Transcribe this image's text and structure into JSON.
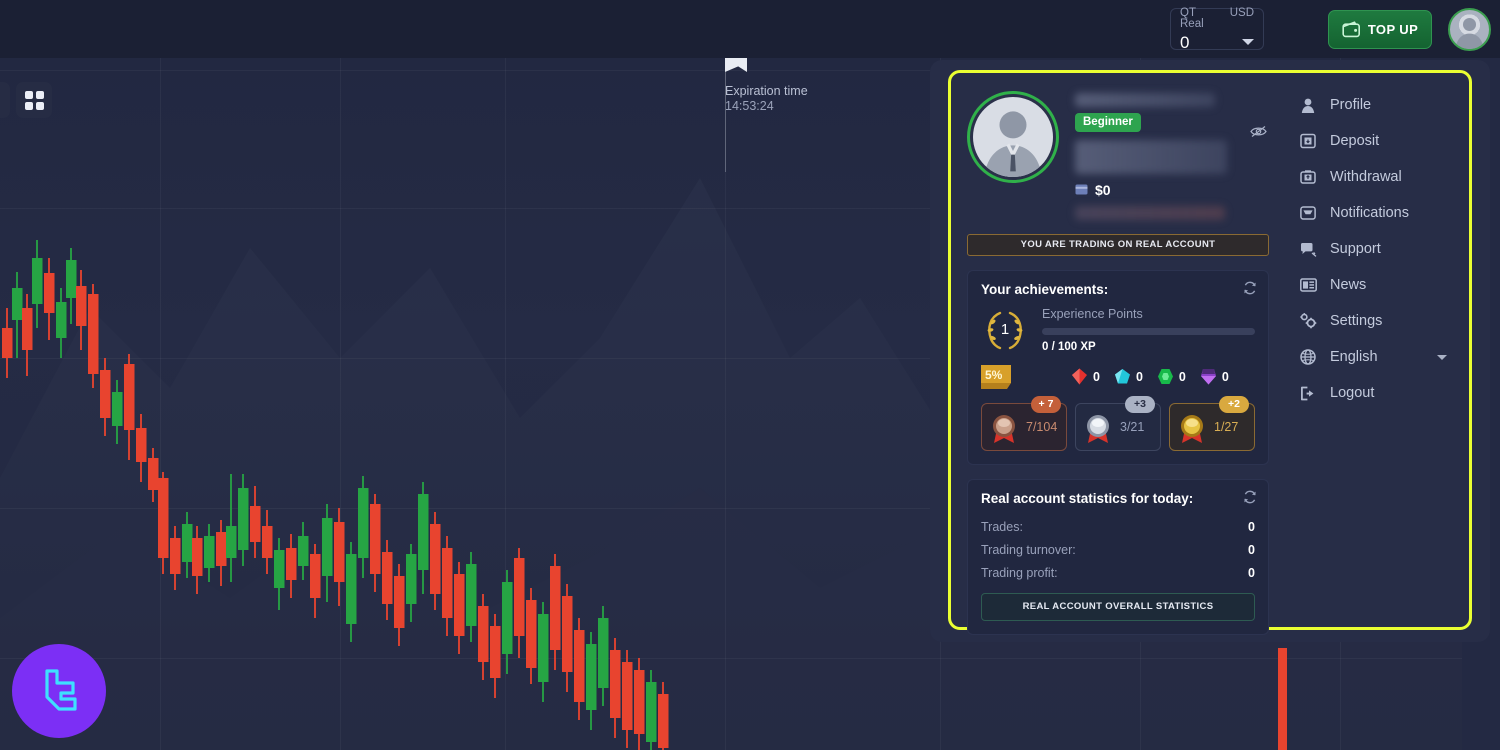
{
  "topbar": {
    "account_label": "QT Real",
    "currency": "USD",
    "balance": "0",
    "topup_label": "TOP UP",
    "wallet_icon": "wallet-icon",
    "caret_icon": "chevron-down-icon",
    "avatar_icon": "user-avatar-icon"
  },
  "toolbar": {
    "grid_icon": "grid-apps-icon"
  },
  "chart": {
    "expiration_label": "Expiration time",
    "expiration_time": "14:53:24",
    "flag_icon": "flag-marker-icon",
    "logo_icon": "brand-logo-icon",
    "bull_color": "#26a544",
    "bear_color": "#e8442f"
  },
  "panel": {
    "badge": "Beginner",
    "balance": "$0",
    "card_icon": "credit-card-icon",
    "eye_icon": "eye-hidden-icon",
    "real_account_banner": "YOU ARE TRADING ON REAL ACCOUNT",
    "achievements": {
      "title": "Your achievements:",
      "refresh_icon": "refresh-icon",
      "level": "1",
      "xp_label": "Experience Points",
      "xp_value": "0 / 100 XP",
      "xp_percent": 0,
      "discount_badge": "5%",
      "gems": [
        {
          "name": "ruby-gem-icon",
          "color": "#e5312e",
          "count": "0"
        },
        {
          "name": "topaz-gem-icon",
          "color": "#22c7da",
          "count": "0"
        },
        {
          "name": "emerald-gem-icon",
          "color": "#18b94a",
          "count": "0"
        },
        {
          "name": "amethyst-gem-icon",
          "color": "#8b42c9",
          "count": "0"
        }
      ],
      "medals": [
        {
          "name": "bronze-medal",
          "plus": "+ 7",
          "count": "7/104",
          "color": "#c4603a"
        },
        {
          "name": "silver-medal",
          "plus": "+3",
          "count": "3/21",
          "color": "#aab2c4"
        },
        {
          "name": "gold-medal",
          "plus": "+2",
          "count": "1/27",
          "color": "#d9a93f"
        }
      ]
    },
    "statistics": {
      "title": "Real account statistics for today:",
      "refresh_icon": "refresh-icon",
      "rows": [
        {
          "key": "Trades:",
          "value": "0"
        },
        {
          "key": "Trading turnover:",
          "value": "0"
        },
        {
          "key": "Trading profit:",
          "value": "0"
        }
      ],
      "overall_button": "REAL ACCOUNT OVERALL STATISTICS"
    },
    "menu": [
      {
        "label": "Profile",
        "icon": "user-icon"
      },
      {
        "label": "Deposit",
        "icon": "deposit-icon"
      },
      {
        "label": "Withdrawal",
        "icon": "withdrawal-icon"
      },
      {
        "label": "Notifications",
        "icon": "inbox-icon"
      },
      {
        "label": "Support",
        "icon": "support-icon"
      },
      {
        "label": "News",
        "icon": "news-icon"
      },
      {
        "label": "Settings",
        "icon": "settings-gear-icon"
      },
      {
        "label": "English",
        "icon": "globe-icon",
        "caret": true
      },
      {
        "label": "Logout",
        "icon": "logout-icon"
      }
    ]
  },
  "colors": {
    "highlight": "#eaff32",
    "accent_green": "#2ea44f",
    "panel_bg": "#272d47"
  }
}
